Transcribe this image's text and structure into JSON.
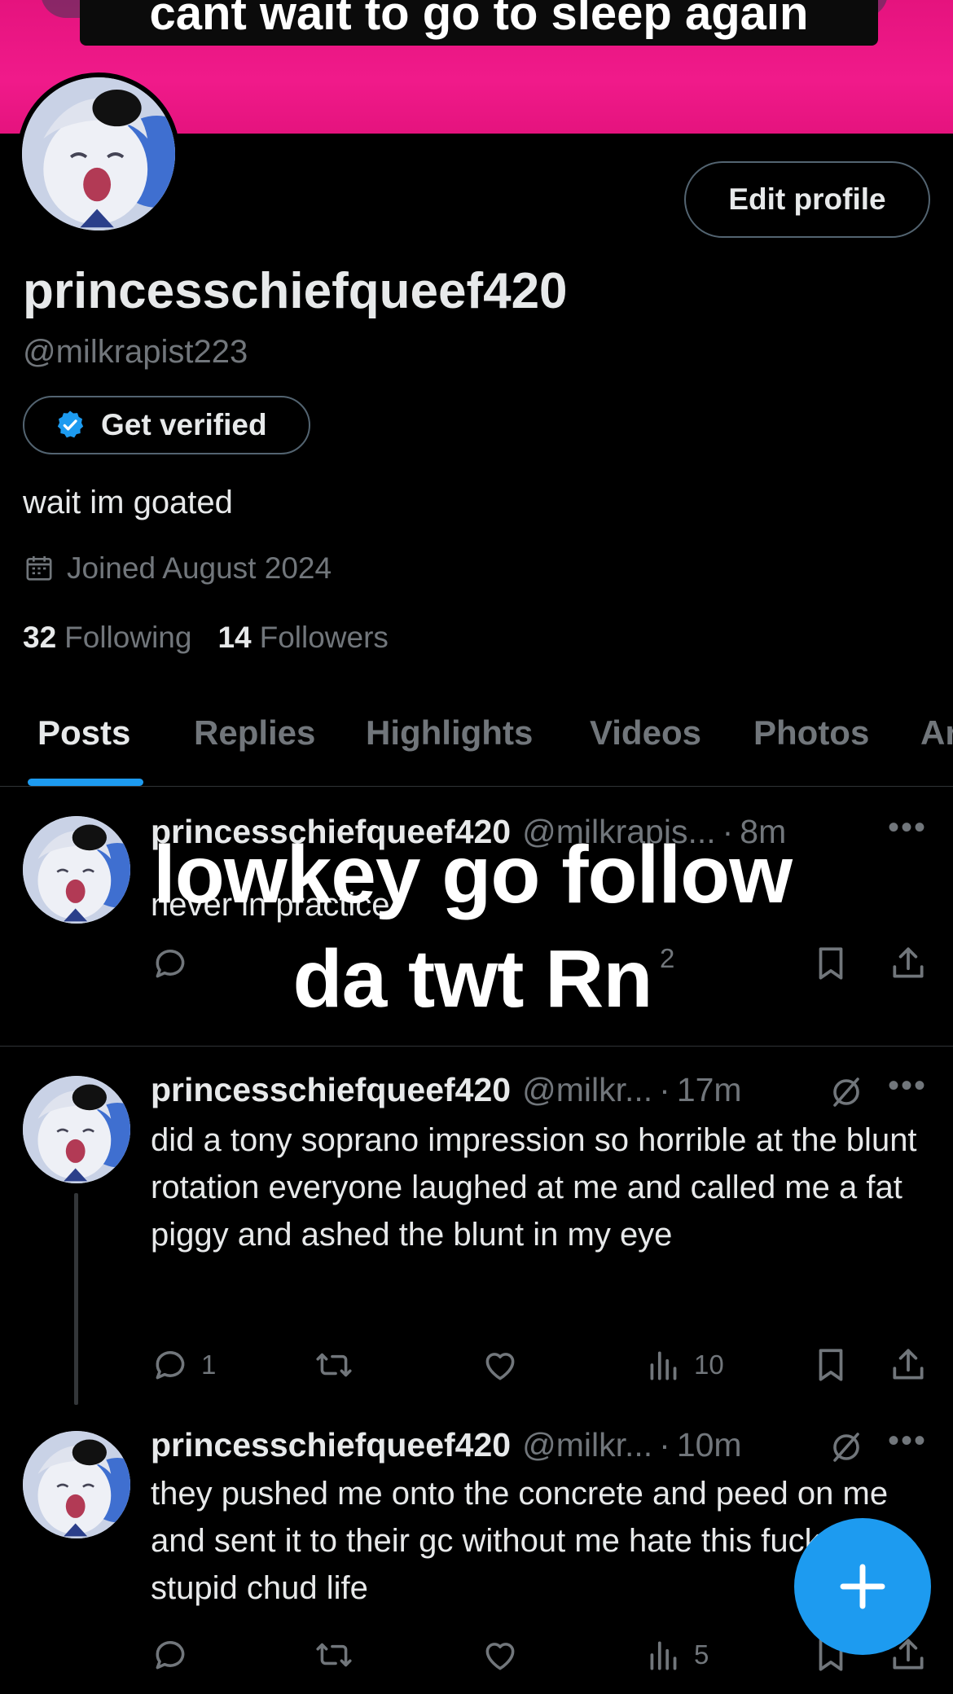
{
  "banner": {
    "caption": "cant wait to go to sleep again"
  },
  "profile": {
    "edit_label": "Edit profile",
    "display_name": "princesschiefqueef420",
    "handle": "@milkrapist223",
    "verify_label": "Get verified",
    "bio": "wait im goated",
    "joined": "Joined August 2024",
    "following_count": "32",
    "following_label": "Following",
    "followers_count": "14",
    "followers_label": "Followers"
  },
  "tabs": [
    "Posts",
    "Replies",
    "Highlights",
    "Videos",
    "Photos",
    "Ar"
  ],
  "posts": [
    {
      "name": "princesschiefqueef420",
      "handle": "@milkrapis...",
      "time": "8m",
      "text_line1": "",
      "text_line2": "never in practice",
      "views": "2"
    },
    {
      "name": "princesschiefqueef420",
      "handle": "@milkr...",
      "time": "17m",
      "text": "did a tony soprano impression so horrible at the blunt rotation everyone laughed at me and called me a fat piggy and ashed the blunt in my eye",
      "replies": "1",
      "views": "10"
    },
    {
      "name": "princesschiefqueef420",
      "handle": "@milkr...",
      "time": "10m",
      "text": "they pushed me onto the  concrete and peed on me and sent it to their gc without me hate this fuck my stupid chud life",
      "views": "5"
    }
  ],
  "overlay": {
    "line1": "lowkey go follow",
    "line2": "da twt Rn"
  },
  "colors": {
    "accent": "#1d9bf0",
    "banner": "#e5137e",
    "muted": "#71767b"
  },
  "icons": {
    "verify": "verified-badge-icon",
    "calendar": "calendar-icon",
    "reply": "reply-icon",
    "repost": "repost-icon",
    "like": "heart-icon",
    "views": "views-icon",
    "bookmark": "bookmark-icon",
    "share": "share-icon",
    "compose": "plus-icon"
  }
}
